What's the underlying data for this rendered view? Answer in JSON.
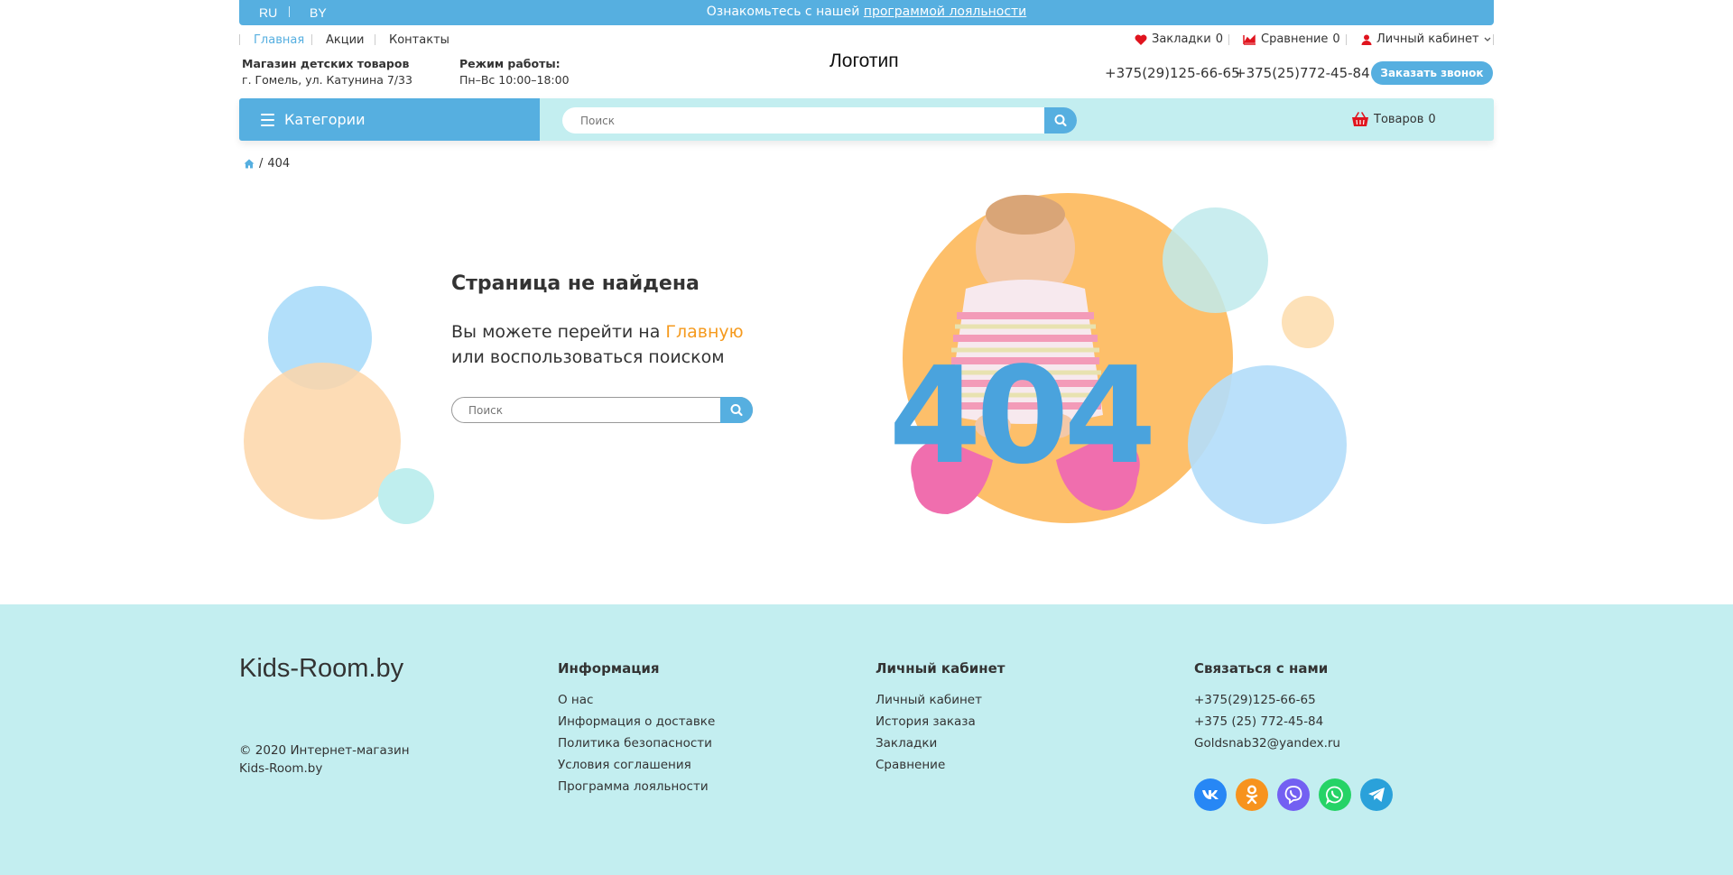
{
  "topbar": {
    "lang_ru": "RU",
    "lang_by": "BY",
    "promo_text": "Ознакомьтесь с нашей",
    "promo_link": "программой лояльности"
  },
  "nav": {
    "home": "Главная",
    "promotions": "Акции",
    "contacts": "Контакты",
    "bookmarks": "Закладки",
    "bookmarks_count": "0",
    "compare": "Сравнение",
    "compare_count": "0",
    "account": "Личный кабинет"
  },
  "info": {
    "shop_title": "Магазин детских товаров",
    "shop_address": "г. Гомель, ул. Катунина 7/33",
    "hours_title": "Режим работы:",
    "hours_value": "Пн–Вс 10:00–18:00",
    "logo": "Логотип",
    "phone1": "+375(29)125-66-65",
    "phone2": "+375(25)772-45-84",
    "callback": "Заказать звонок"
  },
  "catbar": {
    "categories": "Категории",
    "search_placeholder": "Поиск",
    "cart_label": "Товаров",
    "cart_count": "0"
  },
  "breadcrumb": {
    "sep": "/",
    "current": "404"
  },
  "notfound": {
    "title": "Страница не найдена",
    "line1_pre": "Вы можете перейти  на",
    "line1_link": "Главную",
    "line2": "или воспользоваться поиском",
    "search_placeholder": "Поиск",
    "big_code": "404"
  },
  "footer": {
    "logo": "Kids-Room.by",
    "copy1": "© 2020 Интернет-магазин",
    "copy2": "Kids-Room.by",
    "col_info": {
      "title": "Информация",
      "links": [
        "О нас",
        "Информация о доставке",
        "Политика безопасности",
        "Условия соглашения",
        "Программа лояльности"
      ]
    },
    "col_account": {
      "title": "Личный кабинет",
      "links": [
        "Личный кабинет",
        "История заказа",
        "Закладки",
        "Сравнение"
      ]
    },
    "col_contact": {
      "title": "Связаться с нами",
      "lines": [
        "+375(29)125-66-65",
        "+375 (25) 772-45-84",
        "Goldsnab32@yandex.ru"
      ]
    },
    "social": [
      "vk-icon",
      "odnoklassniki-icon",
      "viber-icon",
      "whatsapp-icon",
      "telegram-icon"
    ]
  },
  "colors": {
    "accent_blue": "#56afe0",
    "light_teal": "#c3eef0",
    "orange_link": "#f59a1e",
    "peach": "#fdbf6a"
  }
}
